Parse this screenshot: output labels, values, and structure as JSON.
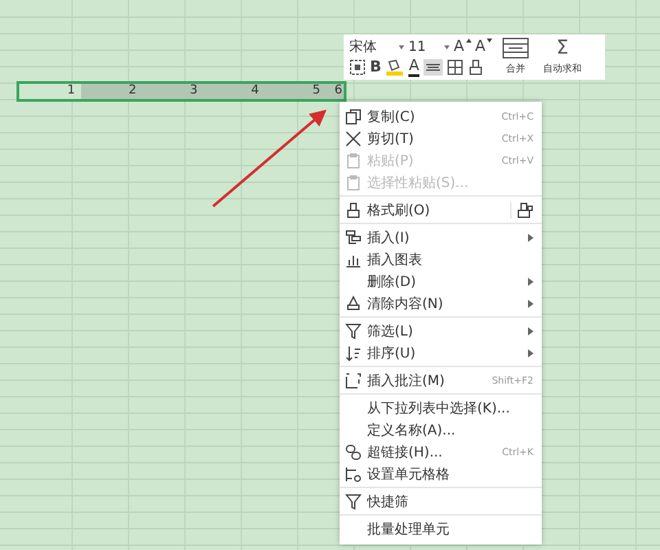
{
  "sheet": {
    "selected_row": [
      {
        "value": "1",
        "active": true
      },
      {
        "value": "2",
        "active": false
      },
      {
        "value": "3",
        "active": false
      },
      {
        "value": "4",
        "active": false
      },
      {
        "value": "5",
        "active": false
      },
      {
        "value": "6",
        "active": false
      }
    ]
  },
  "toolbar": {
    "font": "宋体",
    "size": "11",
    "grow": "A",
    "shrink": "A",
    "sum": "Σ",
    "bold": "B",
    "font_color": "A",
    "merge": "合并",
    "autosum": "自动求和",
    "align_selected": true
  },
  "context_menu": {
    "items": [
      {
        "kind": "item",
        "label": "复制(C)",
        "shortcut": "Ctrl+C",
        "disabled": false,
        "submenu": false,
        "trailing_icon": false
      },
      {
        "kind": "item",
        "label": "剪切(T)",
        "shortcut": "Ctrl+X",
        "disabled": false,
        "submenu": false,
        "trailing_icon": false
      },
      {
        "kind": "item",
        "label": "粘贴(P)",
        "shortcut": "Ctrl+V",
        "disabled": true,
        "submenu": false,
        "trailing_icon": false
      },
      {
        "kind": "item",
        "label": "选择性粘贴(S)...",
        "disabled": true,
        "submenu": false,
        "trailing_icon": false
      },
      {
        "kind": "separator"
      },
      {
        "kind": "item",
        "label": "格式刷(O)",
        "disabled": false,
        "submenu": false,
        "trailing_icon": true
      },
      {
        "kind": "separator"
      },
      {
        "kind": "item",
        "label": "插入(I)",
        "disabled": false,
        "submenu": true,
        "trailing_icon": false
      },
      {
        "kind": "item",
        "label": "插入图表",
        "disabled": false,
        "submenu": false,
        "trailing_icon": false
      },
      {
        "kind": "item",
        "label": "删除(D)",
        "disabled": false,
        "submenu": true,
        "trailing_icon": false
      },
      {
        "kind": "item",
        "label": "清除内容(N)",
        "disabled": false,
        "submenu": true,
        "trailing_icon": false
      },
      {
        "kind": "separator"
      },
      {
        "kind": "item",
        "label": "筛选(L)",
        "disabled": false,
        "submenu": true,
        "trailing_icon": false
      },
      {
        "kind": "item",
        "label": "排序(U)",
        "disabled": false,
        "submenu": true,
        "trailing_icon": false
      },
      {
        "kind": "separator"
      },
      {
        "kind": "item",
        "label": "插入批注(M)",
        "shortcut": "Shift+F2",
        "disabled": false,
        "submenu": false,
        "trailing_icon": false
      },
      {
        "kind": "separator"
      },
      {
        "kind": "item",
        "label": "从下拉列表中选择(K)...",
        "disabled": false,
        "submenu": false,
        "trailing_icon": false
      },
      {
        "kind": "item",
        "label": "定义名称(A)...",
        "disabled": false,
        "submenu": false,
        "trailing_icon": false
      },
      {
        "kind": "item",
        "label": "超链接(H)...",
        "shortcut": "Ctrl+K",
        "disabled": false,
        "submenu": false,
        "trailing_icon": false
      },
      {
        "kind": "item",
        "label": "设置单元格格",
        "disabled": false,
        "submenu": false,
        "trailing_icon": false
      },
      {
        "kind": "separator"
      },
      {
        "kind": "item",
        "label": "快捷筛",
        "disabled": false,
        "submenu": false,
        "trailing_icon": false
      },
      {
        "kind": "separator"
      },
      {
        "kind": "item",
        "label": "批量处理单元",
        "disabled": false,
        "submenu": false,
        "trailing_icon": false
      }
    ]
  }
}
